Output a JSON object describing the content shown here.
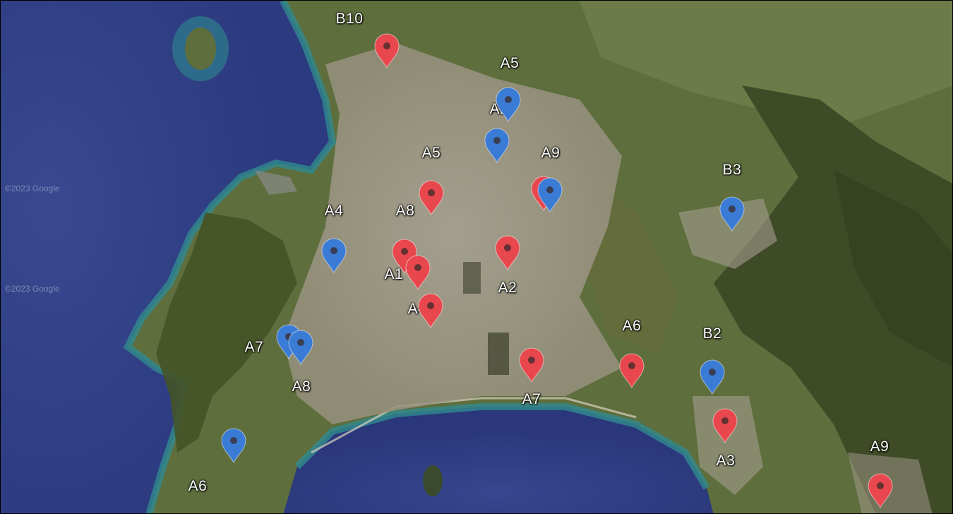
{
  "map": {
    "watermarks": [
      "©2023 Google",
      "©2023 Google"
    ],
    "colors": {
      "ocean": "#33458f",
      "ocean_deep": "#2b3a80",
      "shallow_water": "#2f8a8f",
      "land": "#5e6e3d",
      "urban": "#a59c90",
      "mountain": "#3f4a26",
      "marker_red": "#e8474e",
      "marker_blue": "#3a7bd5"
    },
    "icons": {
      "marker": "map-pin-icon"
    },
    "labels": [
      "B10",
      "A5",
      "A1",
      "A5",
      "A9",
      "B3",
      "A4",
      "A8",
      "A1",
      "A2",
      "A4",
      "A6",
      "B2",
      "A7",
      "A8",
      "A7",
      "A3",
      "A9",
      "A6"
    ],
    "markers": [
      {
        "color": "red"
      },
      {
        "color": "blue"
      },
      {
        "color": "blue"
      },
      {
        "color": "red"
      },
      {
        "color": "red"
      },
      {
        "color": "blue"
      },
      {
        "color": "blue"
      },
      {
        "color": "red"
      },
      {
        "color": "red"
      },
      {
        "color": "red"
      },
      {
        "color": "red"
      },
      {
        "color": "blue"
      },
      {
        "color": "blue"
      },
      {
        "color": "red"
      },
      {
        "color": "red"
      },
      {
        "color": "blue"
      },
      {
        "color": "red"
      },
      {
        "color": "blue"
      },
      {
        "color": "red"
      }
    ]
  }
}
